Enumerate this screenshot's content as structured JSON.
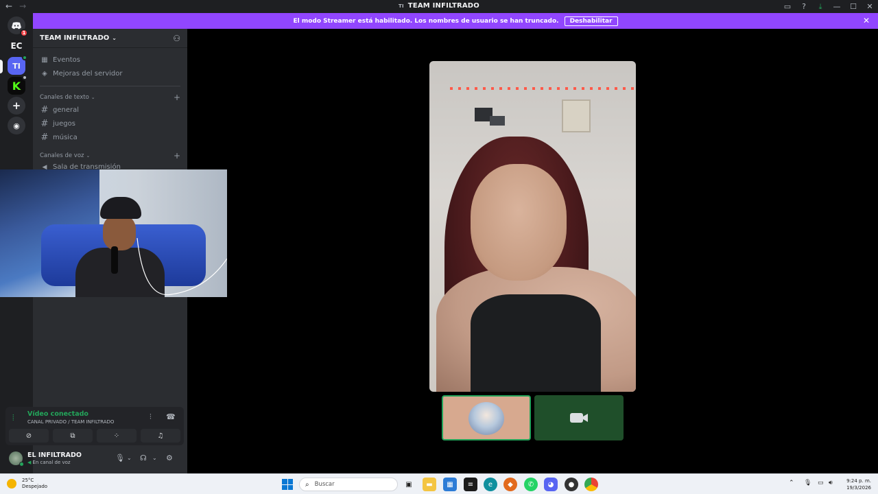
{
  "window": {
    "title": "TEAM INFILTRADO",
    "title_icon": "TI",
    "nav_back": "←",
    "nav_forward": "→"
  },
  "rail": {
    "discord_badge": "1",
    "ec_label": "EC",
    "ti_label": "TI",
    "kick_label": "K"
  },
  "banner": {
    "message": "El modo Streamer está habilitado. Los nombres de usuario se han truncado.",
    "button": "Deshabilitar"
  },
  "sidebar": {
    "server_name": "TEAM INFILTRADO",
    "items": [
      {
        "label": "Eventos",
        "icon": "calendar-icon"
      },
      {
        "label": "Mejoras del servidor",
        "icon": "boost-icon"
      }
    ],
    "text_category": "Canales de texto",
    "text_channels": [
      "general",
      "juegos",
      "música"
    ],
    "voice_category": "Canales de voz",
    "voice_channels": [
      "Sala de transmisión"
    ]
  },
  "voice_panel": {
    "status": "Vídeo conectado",
    "channel": "CANAL PRIVADO / TEAM INFILTRADO"
  },
  "user_panel": {
    "name": "EL INFILTRADO",
    "status": "En canal de voz"
  },
  "taskbar": {
    "temperature": "25°C",
    "weather": "Despejado",
    "search_placeholder": "Buscar",
    "time": "9:24 p. m.",
    "date": "19/3/2026"
  },
  "colors": {
    "streamer_banner": "#9146ff",
    "connected_green": "#23a55a",
    "blurple": "#5865f2"
  }
}
